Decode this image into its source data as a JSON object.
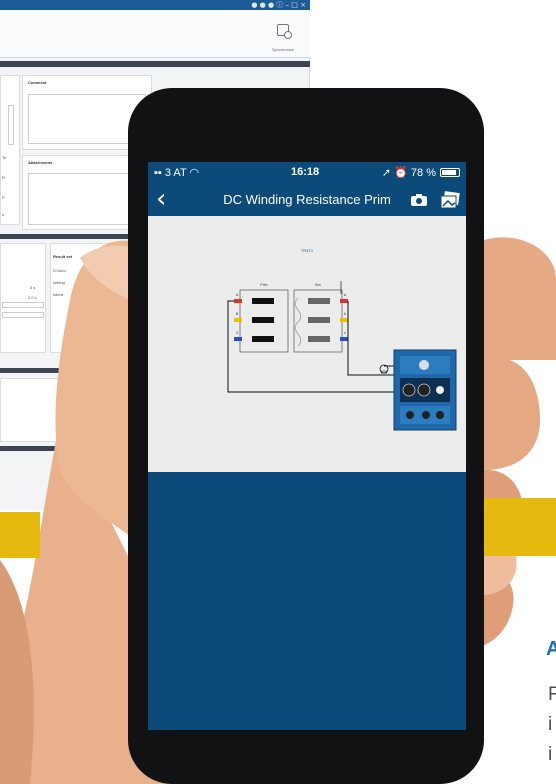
{
  "desktop": {
    "window_controls": "● ● ● ⓘ  – □ ×",
    "ribbon": {
      "sync_label": "Synchronize"
    },
    "panels": {
      "comment_title": "Comment",
      "attachments_title": "Attachments",
      "result_title": "Result set",
      "result_checkbox_label": "Auto",
      "settings_label": "setting",
      "tolerance_label": "tolera",
      "value_1": "5 s",
      "value_2": "2.0 s",
      "side_labels": [
        "Te",
        "R",
        "P",
        "o"
      ]
    }
  },
  "phone": {
    "status_bar": {
      "carrier": "3 AT",
      "time": "16:18",
      "battery_text": "78 %"
    },
    "nav": {
      "title": "DC Winding Resistance Prim"
    },
    "diagram": {
      "title": "TR4T1",
      "primary_label": "Prim",
      "secondary_label": "Sec",
      "terminals_left": [
        "A",
        "B",
        "C"
      ],
      "terminals_right": [
        "a",
        "b",
        "c"
      ]
    }
  },
  "side": {
    "heading_letter": "A",
    "text_lines": [
      "F",
      "i",
      "i"
    ]
  },
  "colors": {
    "app_blue": "#0c4a79",
    "title_bar": "#1f5b96",
    "accent_yellow": "#e6b90e"
  }
}
